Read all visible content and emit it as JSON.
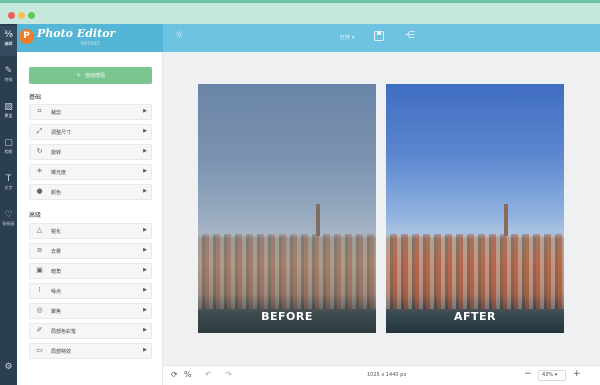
{
  "header": {
    "app_title": "Photo Editor",
    "app_subtitle": "POTOST",
    "menu_label": "打开",
    "colors": {
      "header": "#6ec4e0",
      "rail": "#2c3e52",
      "accent": "#7bc591"
    }
  },
  "rail": {
    "items": [
      {
        "label": "编辑",
        "icon": "sliders-icon"
      },
      {
        "label": "特效",
        "icon": "brush-icon"
      },
      {
        "label": "覆盖",
        "icon": "texture-icon"
      },
      {
        "label": "相框",
        "icon": "frame-icon"
      },
      {
        "label": "文字",
        "icon": "text-icon"
      },
      {
        "label": "贴纸画",
        "icon": "heart-icon"
      }
    ]
  },
  "panel": {
    "auto_button": "自动增强",
    "section_basic": "基础",
    "section_advanced": "高级",
    "basic_tools": [
      {
        "label": "裁剪",
        "icon": "crop-icon"
      },
      {
        "label": "调整尺寸",
        "icon": "resize-icon"
      },
      {
        "label": "旋转",
        "icon": "rotate-icon"
      },
      {
        "label": "曝光度",
        "icon": "exposure-icon"
      },
      {
        "label": "颜色",
        "icon": "color-drop-icon"
      }
    ],
    "advanced_tools": [
      {
        "label": "锐化",
        "icon": "sharpen-icon"
      },
      {
        "label": "去雾",
        "icon": "dehaze-icon"
      },
      {
        "label": "暗角",
        "icon": "vignette-icon"
      },
      {
        "label": "噪点",
        "icon": "noise-icon"
      },
      {
        "label": "聚焦",
        "icon": "focus-icon"
      },
      {
        "label": "局部色彩笔",
        "icon": "color-brush-icon"
      },
      {
        "label": "局部特效",
        "icon": "local-effect-icon"
      }
    ]
  },
  "canvas": {
    "before_label": "BEFORE",
    "after_label": "AFTER"
  },
  "bottombar": {
    "dimensions": "1025 x 1440 px",
    "zoom": "43%"
  }
}
